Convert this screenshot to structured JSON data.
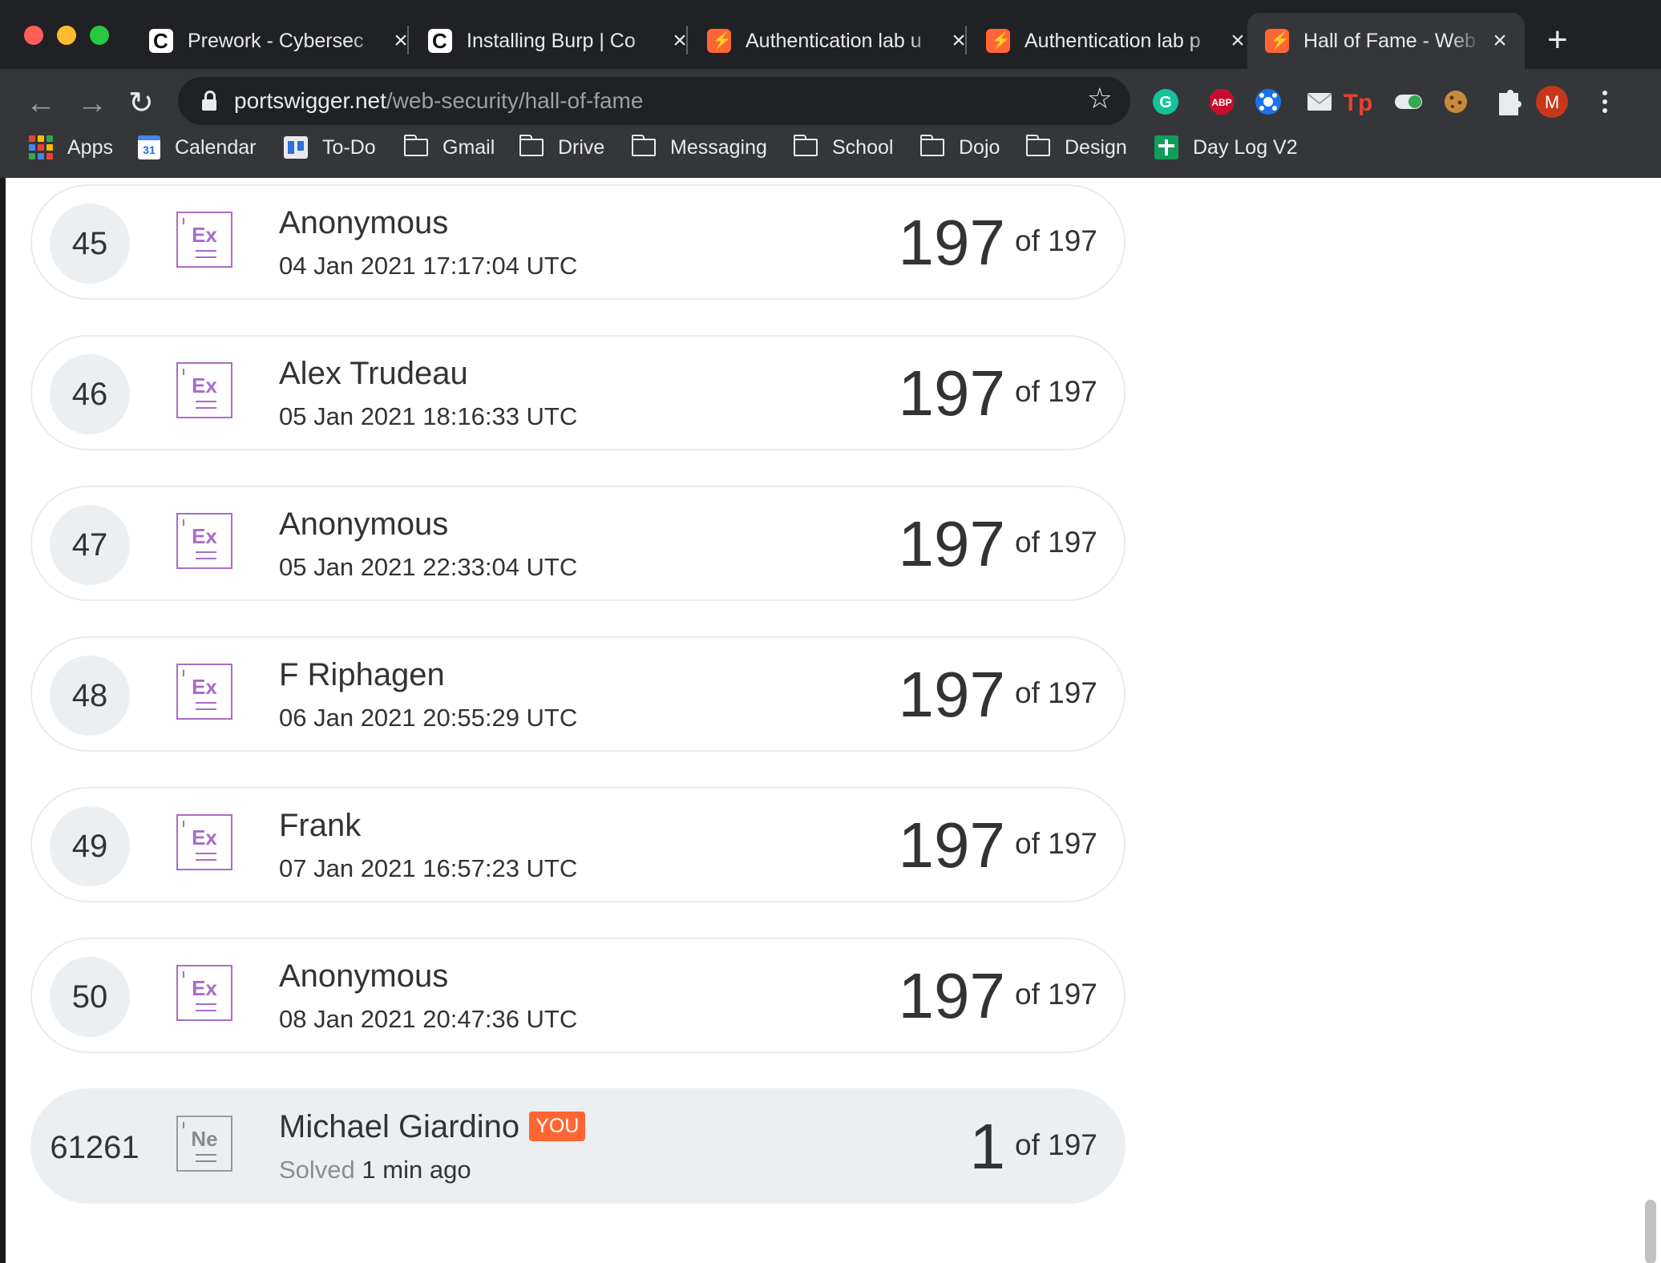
{
  "tabs": [
    {
      "title": "Prework - Cybersec",
      "favicon": "codepath-icon",
      "active": false
    },
    {
      "title": "Installing Burp | Co",
      "favicon": "codepath-icon",
      "active": false
    },
    {
      "title": "Authentication lab u",
      "favicon": "portswigger-icon",
      "active": false
    },
    {
      "title": "Authentication lab p",
      "favicon": "portswigger-icon",
      "active": false
    },
    {
      "title": "Hall of Fame - Web",
      "favicon": "portswigger-icon",
      "active": true
    }
  ],
  "toolbar": {
    "url_domain": "portswigger.net",
    "url_path": "/web-security/hall-of-fame",
    "profile_initial": "M",
    "abp_label": "ABP",
    "tp_label": "Tp"
  },
  "bookmarks": [
    {
      "label": "Apps",
      "icon": "apps-grid-icon"
    },
    {
      "label": "Calendar",
      "icon": "calendar-icon"
    },
    {
      "label": "To-Do",
      "icon": "todo-icon"
    },
    {
      "label": "Gmail",
      "icon": "folder-icon"
    },
    {
      "label": "Drive",
      "icon": "folder-icon"
    },
    {
      "label": "Messaging",
      "icon": "folder-icon"
    },
    {
      "label": "School",
      "icon": "folder-icon"
    },
    {
      "label": "Dojo",
      "icon": "folder-icon"
    },
    {
      "label": "Design",
      "icon": "folder-icon"
    },
    {
      "label": "Day Log V2",
      "icon": "daylog-icon"
    }
  ],
  "calendar_day": "31",
  "leaderboard": [
    {
      "rank": "45",
      "badge": "Ex",
      "name": "Anonymous",
      "date": "04 Jan 2021 17:17:04 UTC",
      "score": "197",
      "total": "of 197"
    },
    {
      "rank": "46",
      "badge": "Ex",
      "name": "Alex Trudeau",
      "date": "05 Jan 2021 18:16:33 UTC",
      "score": "197",
      "total": "of 197"
    },
    {
      "rank": "47",
      "badge": "Ex",
      "name": "Anonymous",
      "date": "05 Jan 2021 22:33:04 UTC",
      "score": "197",
      "total": "of 197"
    },
    {
      "rank": "48",
      "badge": "Ex",
      "name": "F Riphagen",
      "date": "06 Jan 2021 20:55:29 UTC",
      "score": "197",
      "total": "of 197"
    },
    {
      "rank": "49",
      "badge": "Ex",
      "name": "Frank",
      "date": "07 Jan 2021 16:57:23 UTC",
      "score": "197",
      "total": "of 197"
    },
    {
      "rank": "50",
      "badge": "Ex",
      "name": "Anonymous",
      "date": "08 Jan 2021 20:47:36 UTC",
      "score": "197",
      "total": "of 197"
    }
  ],
  "current_user": {
    "rank": "61261",
    "badge": "Ne",
    "name": "Michael Giardino",
    "you_tag": "YOU",
    "solved_label": "Solved",
    "solved_time": "1 min ago",
    "score": "1",
    "total": "of 197"
  },
  "colors": {
    "accent": "#ff6633",
    "expert_badge": "#a96cc8",
    "row_border": "#e8ebef"
  }
}
